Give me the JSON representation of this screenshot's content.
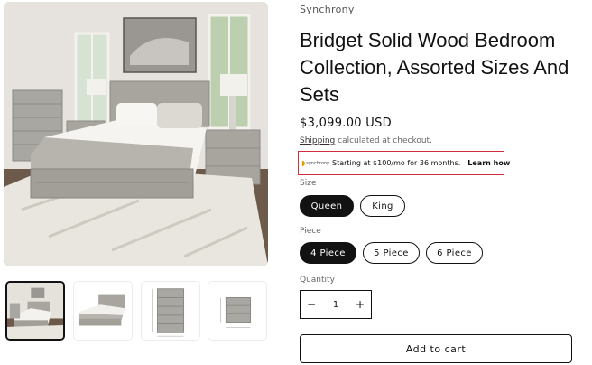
{
  "product": {
    "vendor": "Synchrony",
    "title": "Bridget Solid Wood Bedroom Collection, Assorted Sizes And Sets",
    "price": "$3,099.00 USD"
  },
  "shipping": {
    "link_label": "Shipping",
    "text": " calculated at checkout."
  },
  "promo": {
    "logo_text": "synchrony",
    "text": "Starting at $100/mo for 36 months.",
    "link_label": "Learn how",
    "border_color": "#d32d3c"
  },
  "options": {
    "size": {
      "label": "Size",
      "values": [
        "Queen",
        "King"
      ],
      "selected": "Queen"
    },
    "piece": {
      "label": "Piece",
      "values": [
        "4 Piece",
        "5 Piece",
        "6 Piece"
      ],
      "selected": "4 Piece"
    }
  },
  "quantity": {
    "label": "Quantity",
    "value": "1",
    "minus": "−",
    "plus": "+"
  },
  "cart": {
    "add_label": "Add to cart"
  },
  "gallery": {
    "main_image": "bedroom-set-photo",
    "thumbnails": [
      "bedroom-scene",
      "bed-frame",
      "chest-of-drawers",
      "nightstand"
    ],
    "active_thumbnail": 0
  }
}
